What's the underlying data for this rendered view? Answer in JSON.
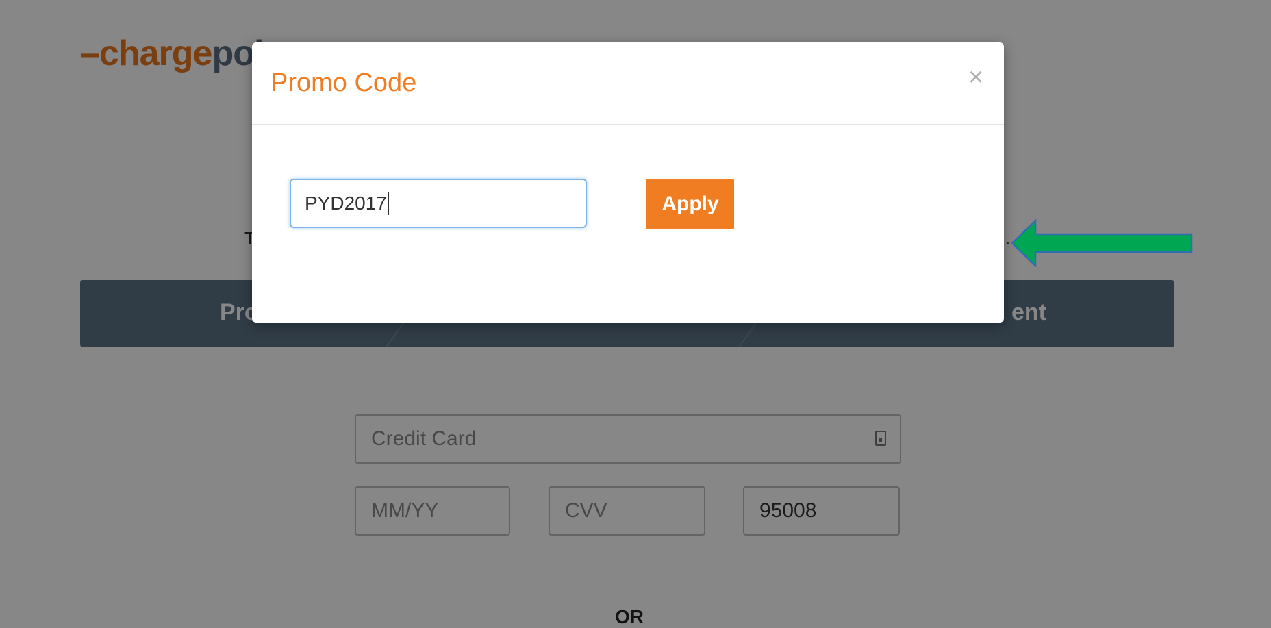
{
  "background_page": {
    "logo": {
      "dash": "–",
      "part1": "charge",
      "part2": "poi"
    },
    "steps_text_left": "T",
    "steps_text_right": ".",
    "steps": [
      {
        "label": "Pro"
      },
      {
        "label": "ent"
      }
    ],
    "payment": {
      "credit_card_placeholder": "Credit Card",
      "expiry_placeholder": "MM/YY",
      "cvv_placeholder": "CVV",
      "zip_value": "95008"
    },
    "or_label": "OR"
  },
  "modal": {
    "title": "Promo Code",
    "close_label": "×",
    "promo_input_value": "PYD2017",
    "apply_label": "Apply"
  },
  "colors": {
    "accent": "#f07d22",
    "steps_bar": "#5c7285",
    "arrow_fill": "#00a651",
    "arrow_stroke": "#2e6fb3"
  },
  "icons": {
    "close": "close-icon",
    "card": "card-icon",
    "arrow": "arrow-left-icon"
  }
}
